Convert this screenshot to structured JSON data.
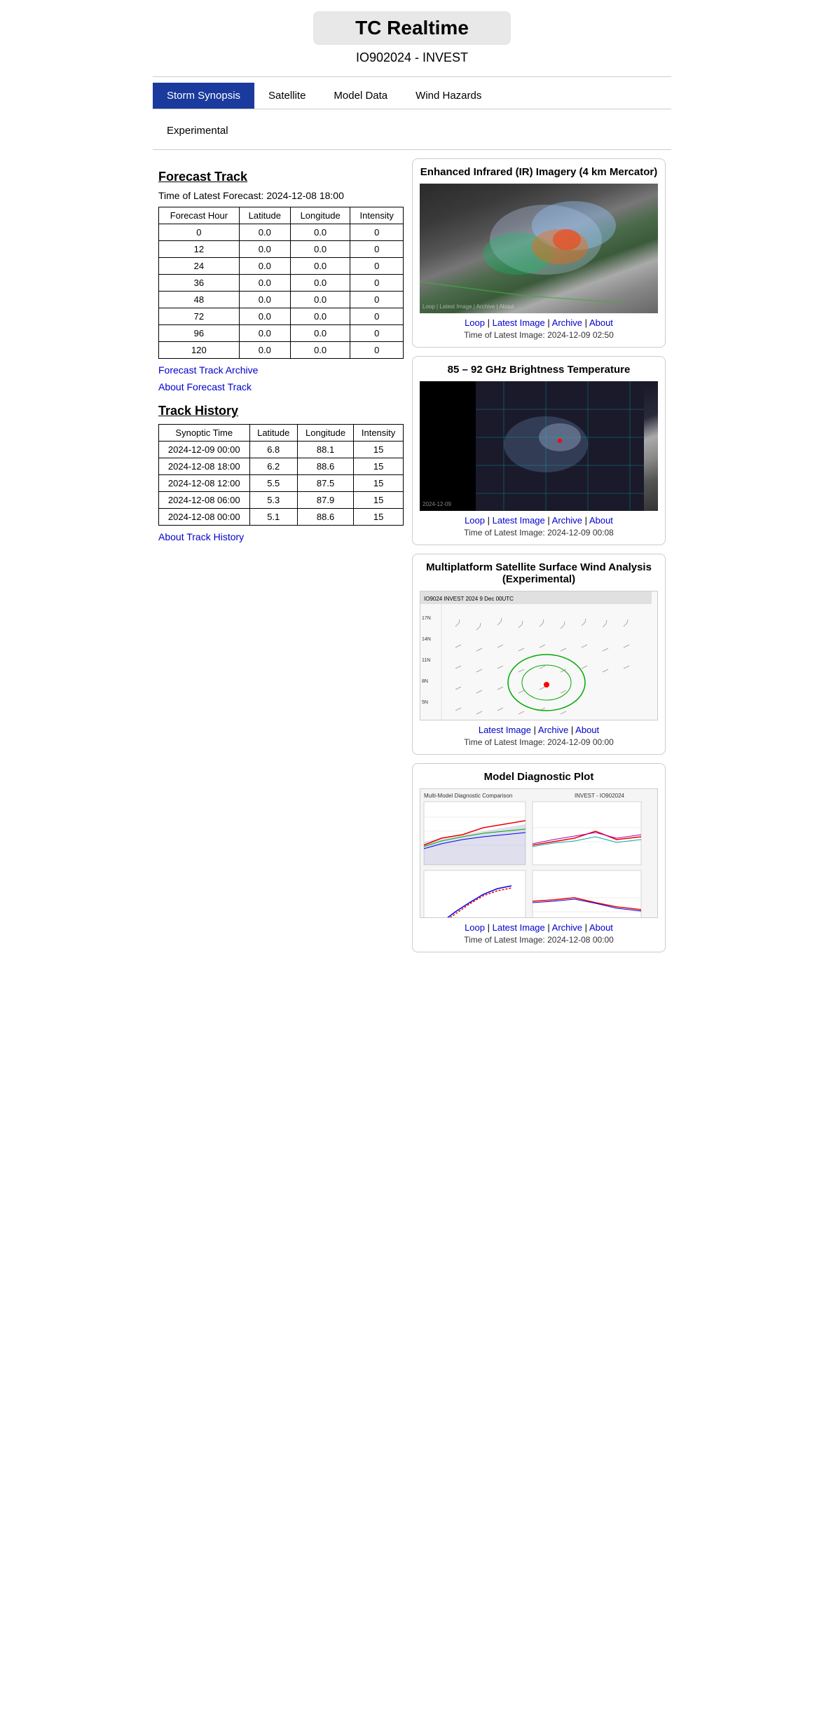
{
  "header": {
    "title": "TC Realtime",
    "subtitle": "IO902024 - INVEST"
  },
  "nav": {
    "items": [
      {
        "label": "Storm Synopsis",
        "active": true
      },
      {
        "label": "Satellite",
        "active": false
      },
      {
        "label": "Model Data",
        "active": false
      },
      {
        "label": "Wind Hazards",
        "active": false
      }
    ],
    "row2": [
      {
        "label": "Experimental",
        "active": false
      }
    ]
  },
  "forecast_track": {
    "section_title": "Forecast Track",
    "latest_forecast_label": "Time of Latest Forecast: 2024-12-08 18:00",
    "table_headers": [
      "Forecast Hour",
      "Latitude",
      "Longitude",
      "Intensity"
    ],
    "table_rows": [
      {
        "hour": "0",
        "lat": "0.0",
        "lon": "0.0",
        "intensity": "0"
      },
      {
        "hour": "12",
        "lat": "0.0",
        "lon": "0.0",
        "intensity": "0"
      },
      {
        "hour": "24",
        "lat": "0.0",
        "lon": "0.0",
        "intensity": "0"
      },
      {
        "hour": "36",
        "lat": "0.0",
        "lon": "0.0",
        "intensity": "0"
      },
      {
        "hour": "48",
        "lat": "0.0",
        "lon": "0.0",
        "intensity": "0"
      },
      {
        "hour": "72",
        "lat": "0.0",
        "lon": "0.0",
        "intensity": "0"
      },
      {
        "hour": "96",
        "lat": "0.0",
        "lon": "0.0",
        "intensity": "0"
      },
      {
        "hour": "120",
        "lat": "0.0",
        "lon": "0.0",
        "intensity": "0"
      }
    ],
    "archive_link": "Forecast Track Archive",
    "about_link": "About Forecast Track"
  },
  "track_history": {
    "section_title": "Track History",
    "table_headers": [
      "Synoptic Time",
      "Latitude",
      "Longitude",
      "Intensity"
    ],
    "table_rows": [
      {
        "time": "2024-12-09 00:00",
        "lat": "6.8",
        "lon": "88.1",
        "intensity": "15"
      },
      {
        "time": "2024-12-08 18:00",
        "lat": "6.2",
        "lon": "88.6",
        "intensity": "15"
      },
      {
        "time": "2024-12-08 12:00",
        "lat": "5.5",
        "lon": "87.5",
        "intensity": "15"
      },
      {
        "time": "2024-12-08 06:00",
        "lat": "5.3",
        "lon": "87.9",
        "intensity": "15"
      },
      {
        "time": "2024-12-08 00:00",
        "lat": "5.1",
        "lon": "88.6",
        "intensity": "15"
      }
    ],
    "about_link": "About Track History"
  },
  "satellite_panels": [
    {
      "id": "ir",
      "title": "Enhanced Infrared (IR) Imagery (4 km Mercator)",
      "image_type": "ir",
      "links": [
        "Loop",
        "Latest Image",
        "Archive",
        "About"
      ],
      "time_label": "Time of Latest Image: 2024-12-09 02:50"
    },
    {
      "id": "microwave",
      "title": "85 – 92 GHz Brightness Temperature",
      "image_type": "mw",
      "links": [
        "Loop",
        "Latest Image",
        "Archive",
        "About"
      ],
      "time_label": "Time of Latest Image: 2024-12-09 00:08"
    },
    {
      "id": "wind",
      "title": "Multiplatform Satellite Surface Wind Analysis (Experimental)",
      "image_type": "wind",
      "links": [
        "Latest Image",
        "Archive",
        "About"
      ],
      "time_label": "Time of Latest Image: 2024-12-09 00:00"
    },
    {
      "id": "model",
      "title": "Model Diagnostic Plot",
      "image_type": "model",
      "links": [
        "Loop",
        "Latest Image",
        "Archive",
        "About"
      ],
      "time_label": "Time of Latest Image: 2024-12-08 00:00"
    }
  ]
}
